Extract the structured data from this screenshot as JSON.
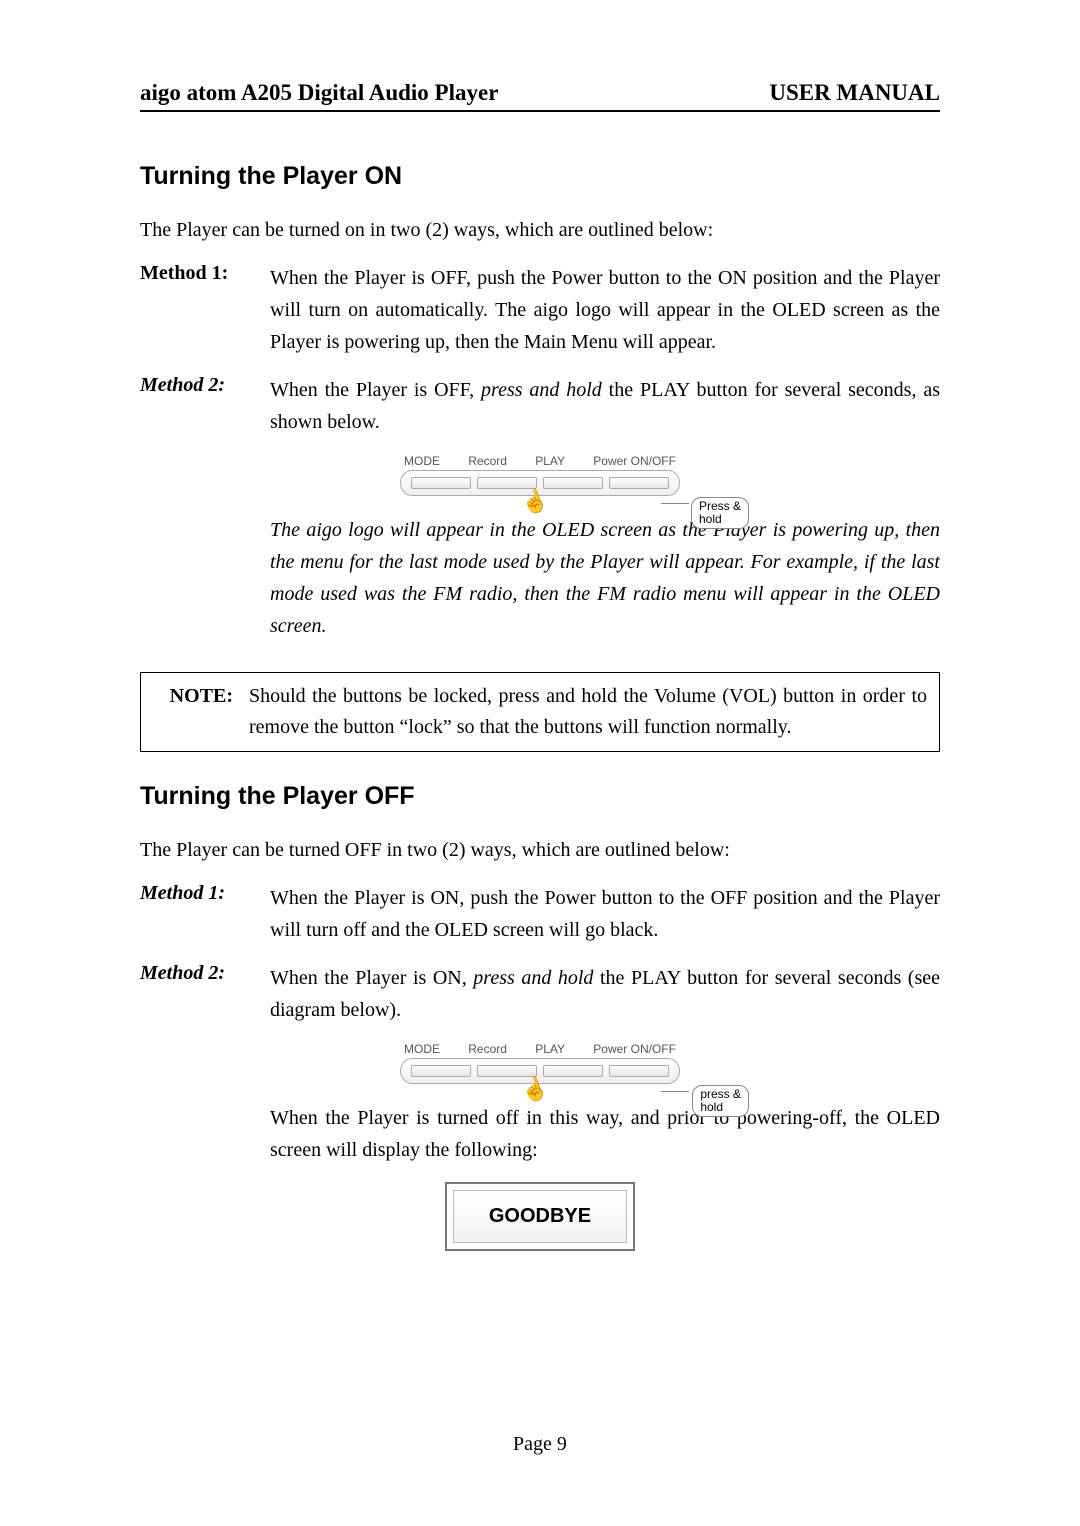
{
  "header": {
    "left": "aigo atom A205 Digital Audio Player",
    "right": "USER MANUAL"
  },
  "section_on": {
    "title": "Turning the Player ON",
    "intro": "The Player can be turned on in two (2) ways, which are outlined below:",
    "method1_label": "Method 1:",
    "method1_body": "When the Player is OFF, push the Power button to the ON position and the Player will turn on automatically.   The aigo logo will appear in the OLED screen as the Player is powering up, then the Main Menu will appear.",
    "method2_label": "Method 2:",
    "method2_body_pre": "When the Player is OFF, ",
    "method2_body_em": "press and hold",
    "method2_body_post": " the PLAY button for several seconds, as shown below.",
    "diagram": {
      "labels": [
        "MODE",
        "Record",
        "PLAY",
        "Power ON/OFF"
      ],
      "callout": "Press &\nhold"
    },
    "italic_para": "The aigo logo will appear in the OLED screen as the Player is powering up, then the menu for the last mode used by the Player will appear.   For example, if the last mode used was the FM radio, then the FM radio menu will appear in the OLED screen."
  },
  "note": {
    "label": "NOTE:",
    "body": "Should the buttons be locked, press and hold the Volume (VOL) button in order to remove the button “lock” so that the buttons will function normally."
  },
  "section_off": {
    "title": "Turning the Player OFF",
    "intro": "The Player can be turned OFF in two (2) ways, which are outlined below:",
    "method1_label": "Method 1:",
    "method1_body": "When the Player is ON, push the Power button to the OFF position and the Player will turn off and the OLED screen will go black.",
    "method2_label": "Method 2:",
    "method2_body_pre": "When the Player is ON, ",
    "method2_body_em": "press and hold",
    "method2_body_post": " the PLAY button for several seconds (see diagram below).",
    "diagram": {
      "labels": [
        "MODE",
        "Record",
        "PLAY",
        "Power ON/OFF"
      ],
      "callout": "press &\nhold"
    },
    "after_diagram": "When the Player is turned off in this way, and prior to powering-off, the OLED screen will display the following:",
    "screen_text": "GOODBYE"
  },
  "footer": "Page 9"
}
